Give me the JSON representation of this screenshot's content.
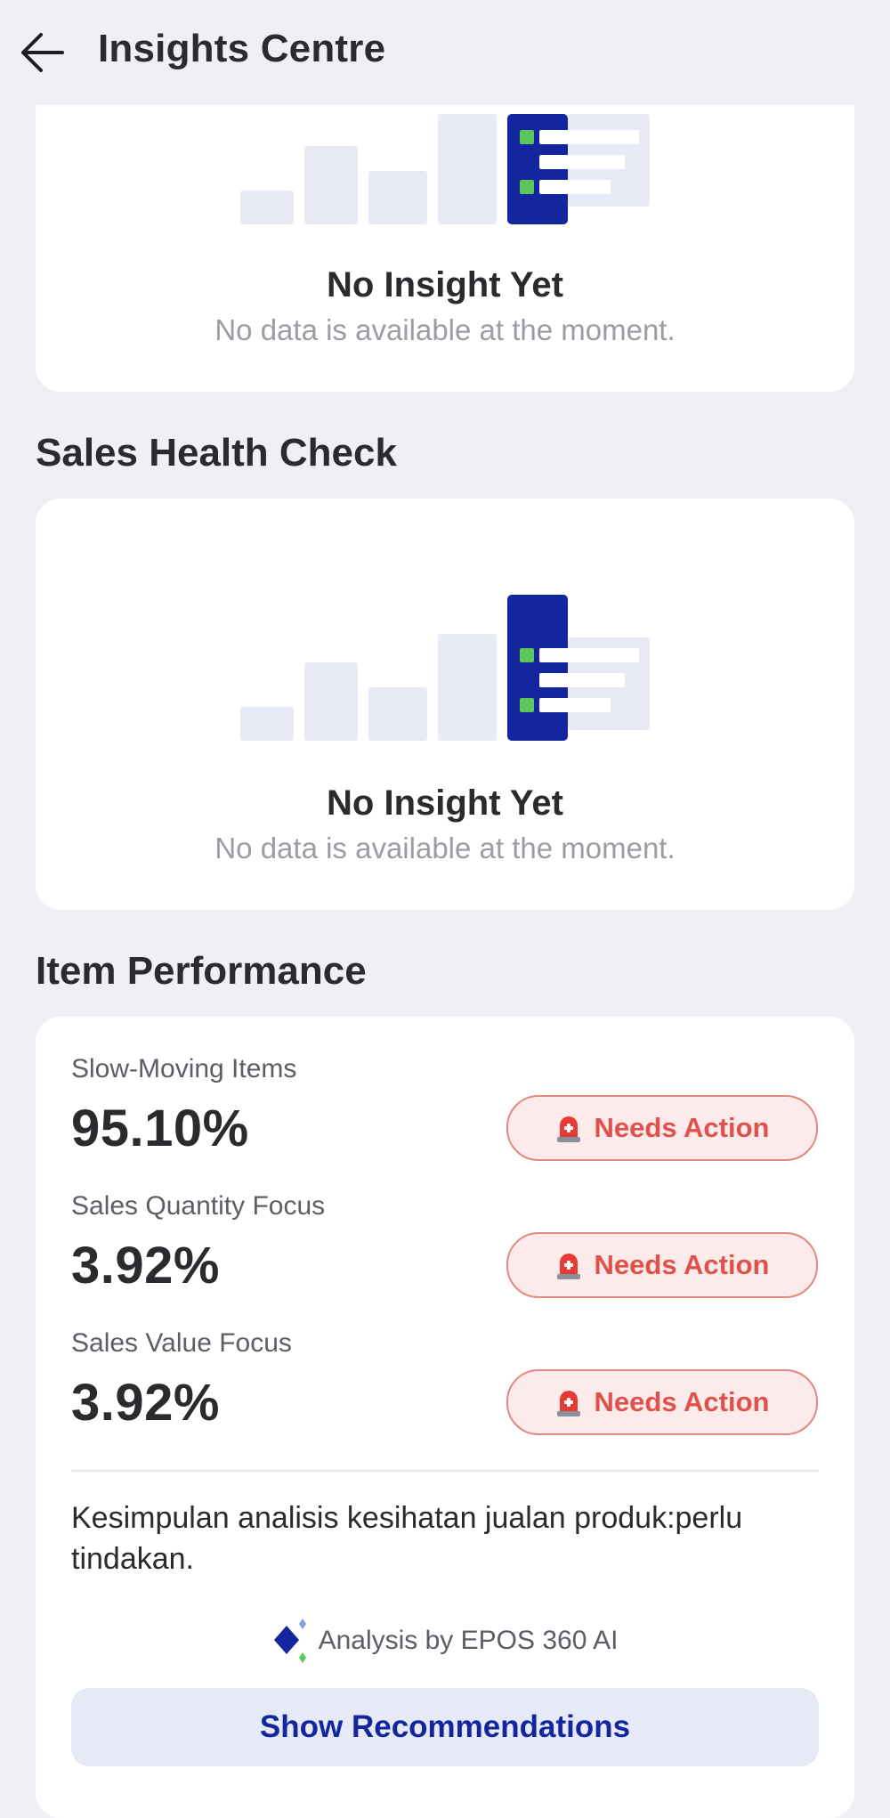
{
  "header": {
    "title": "Insights Centre",
    "back_icon": "arrow-left-icon"
  },
  "top_card": {
    "empty_title": "No Insight Yet",
    "empty_subtitle": "No data is available at the moment."
  },
  "sales_health": {
    "section_title": "Sales Health Check",
    "empty_title": "No Insight Yet",
    "empty_subtitle": "No data is available at the moment."
  },
  "item_performance": {
    "section_title": "Item Performance",
    "metrics": [
      {
        "label": "Slow-Moving Items",
        "value": "95.10%",
        "status": "Needs Action",
        "status_icon": "siren-icon"
      },
      {
        "label": "Sales Quantity Focus",
        "value": "3.92%",
        "status": "Needs Action",
        "status_icon": "siren-icon"
      },
      {
        "label": "Sales Value Focus",
        "value": "3.92%",
        "status": "Needs Action",
        "status_icon": "siren-icon"
      }
    ],
    "conclusion": "Kesimpulan analisis kesihatan jualan produk:perlu tindakan.",
    "attribution": "Analysis by EPOS 360 AI",
    "attribution_icon": "epos-ai-logo-icon",
    "button_label": "Show Recommendations"
  },
  "colors": {
    "background": "#eff0f6",
    "card": "#ffffff",
    "brand_blue": "#13269e",
    "accent_green": "#5bc85b",
    "illustration_light": "#e8eaf6",
    "danger_text": "#e0514c",
    "danger_bg": "#fdeaea",
    "danger_border": "#e08a80",
    "button_bg": "#e6e9f6"
  }
}
